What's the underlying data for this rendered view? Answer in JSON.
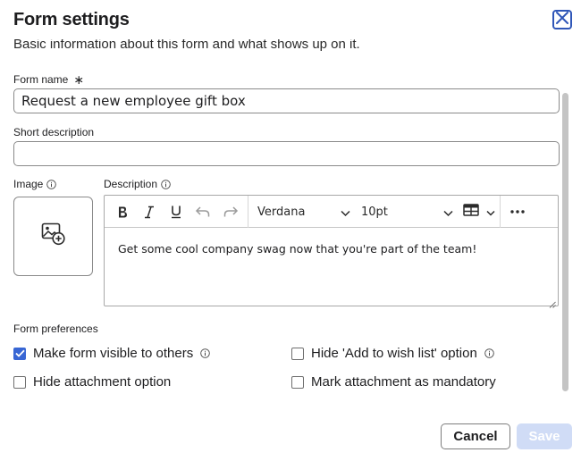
{
  "dialog": {
    "title": "Form settings",
    "close_label": "Close"
  },
  "intro": {
    "text": "Basic information about this form and what shows up on it."
  },
  "fields": {
    "form_name": {
      "label": "Form name",
      "required_mark": "∗",
      "value": "Request a new employee gift box"
    },
    "short_description": {
      "label": "Short description",
      "value": ""
    },
    "image": {
      "label": "Image"
    },
    "description": {
      "label": "Description"
    }
  },
  "editor": {
    "font_family": "Verdana",
    "font_size": "10pt",
    "content": "Get some cool company swag now that you're part of the team!",
    "toolbar_icons": [
      "bold-icon",
      "italic-icon",
      "underline-icon",
      "undo-icon",
      "redo-icon",
      "table-icon",
      "more-icon"
    ]
  },
  "preferences": {
    "section_label": "Form preferences",
    "options": [
      {
        "label": "Make form visible to others",
        "checked": true
      },
      {
        "label": "Hide 'Add to wish list' option",
        "checked": false
      },
      {
        "label": "Hide attachment option",
        "checked": false
      },
      {
        "label": "Mark attachment as mandatory",
        "checked": false
      }
    ]
  },
  "footer": {
    "cancel_label": "Cancel",
    "save_label": "Save"
  },
  "colors": {
    "accent": "#3866d4",
    "close_border": "#2f56b8",
    "save_disabled_bg": "#d0dcf6"
  }
}
